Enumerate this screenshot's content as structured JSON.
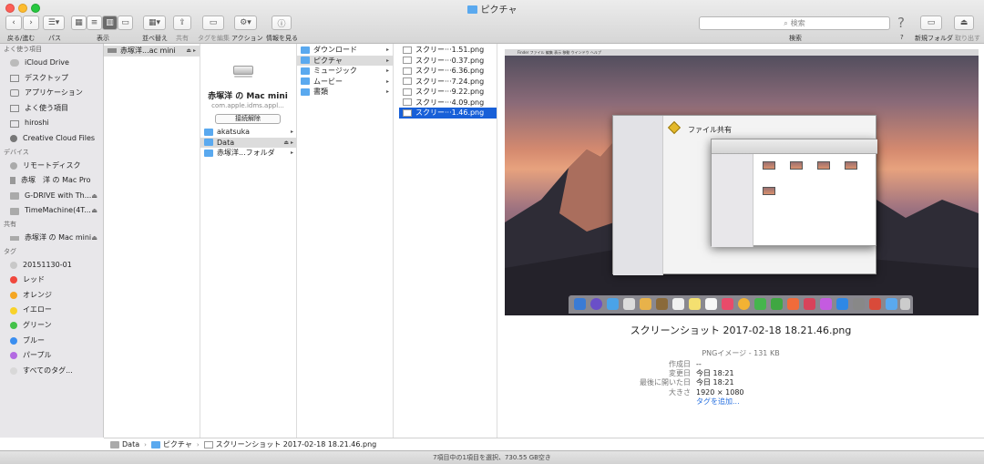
{
  "window": {
    "title": "ピクチャ"
  },
  "toolbar": {
    "back_forward_label": "戻る/進む",
    "path_label": "パス",
    "view_label": "表示",
    "arrange_label": "並べ替え",
    "share_label": "共有",
    "edit_tags_label": "タグを編集",
    "action_label": "アクション",
    "info_label": "情報を見る",
    "search_placeholder": "検索",
    "search_label": "検索",
    "help_label": "?",
    "new_folder_label": "新規フォルダ",
    "eject_label": "取り出す"
  },
  "sidebar": {
    "favorites_header": "よく使う項目",
    "favorites": [
      {
        "label": "iCloud Drive",
        "icon": "cloud-icon"
      },
      {
        "label": "デスクトップ",
        "icon": "desktop-icon"
      },
      {
        "label": "アプリケーション",
        "icon": "applications-icon"
      },
      {
        "label": "よく使う項目",
        "icon": "document-icon"
      },
      {
        "label": "hiroshi",
        "icon": "home-icon"
      },
      {
        "label": "Creative Cloud Files",
        "icon": "creative-cloud-icon"
      }
    ],
    "devices_header": "デバイス",
    "devices": [
      {
        "label": "リモートディスク",
        "icon": "disc-icon"
      },
      {
        "label": "赤塚　洋 の Mac Pro",
        "icon": "computer-icon"
      },
      {
        "label": "G-DRIVE with Th...",
        "icon": "drive-icon",
        "eject": true
      },
      {
        "label": "TimeMachine(4T...",
        "icon": "drive-icon",
        "eject": true
      }
    ],
    "shared_header": "共有",
    "shared": [
      {
        "label": "赤塚洋 の Mac mini",
        "icon": "network-icon",
        "eject": true
      }
    ],
    "tags_header": "タグ",
    "tags": [
      {
        "label": "20151130-01",
        "color": "#c8c8c8"
      },
      {
        "label": "レッド",
        "color": "#f0483e"
      },
      {
        "label": "オレンジ",
        "color": "#f5a623"
      },
      {
        "label": "イエロー",
        "color": "#f8d22a"
      },
      {
        "label": "グリーン",
        "color": "#44c24a"
      },
      {
        "label": "ブルー",
        "color": "#3a8ef0"
      },
      {
        "label": "パープル",
        "color": "#b36ae2"
      },
      {
        "label": "すべてのタグ...",
        "color": "#d8d8d8"
      }
    ]
  },
  "columns": {
    "col1": [
      {
        "label": "赤塚洋...ac mini",
        "icon": "network-icon",
        "eject": true
      }
    ],
    "server": {
      "name": "赤塚洋 の Mac mini",
      "id": "com.apple.idms.appl...",
      "disconnect_label": "接続解除"
    },
    "col2": [
      {
        "label": "akatsuka",
        "arrow": true
      },
      {
        "label": "Data",
        "arrow": true,
        "eject": true,
        "highlight": true
      },
      {
        "label": "赤塚洋...フォルダ",
        "arrow": true
      }
    ],
    "col3": [
      {
        "label": "ダウンロード"
      },
      {
        "label": "ピクチャ",
        "highlight": true
      },
      {
        "label": "ミュージック"
      },
      {
        "label": "ムービー"
      },
      {
        "label": "書類"
      }
    ],
    "col4": [
      {
        "label": "スクリー···1.51.png"
      },
      {
        "label": "スクリー···0.37.png"
      },
      {
        "label": "スクリー···6.36.png"
      },
      {
        "label": "スクリー···7.24.png"
      },
      {
        "label": "スクリー···9.22.png"
      },
      {
        "label": "スクリー···4.09.png"
      },
      {
        "label": "スクリー···1.46.png",
        "selected": true
      }
    ]
  },
  "preview": {
    "filename": "スクリーンショット 2017-02-18 18.21.46.png",
    "kind": "PNGイメージ - 131 KB",
    "meta": [
      {
        "k": "作成日",
        "v": "--"
      },
      {
        "k": "変更日",
        "v": "今日 18:21"
      },
      {
        "k": "最後に開いた日",
        "v": "今日 18:21"
      },
      {
        "k": "大きさ",
        "v": "1920 × 1080"
      }
    ],
    "add_tags_label": "タグを追加...",
    "inner": {
      "window_title": "ファイル共有",
      "menubar": "Finder  ファイル  編集  表示  移動  ウインドウ  ヘルプ"
    }
  },
  "pathbar": [
    "Data",
    "ピクチャ",
    "スクリーンショット 2017-02-18 18.21.46.png"
  ],
  "status": "7項目中の1項目を選択、730.55 GB空き"
}
